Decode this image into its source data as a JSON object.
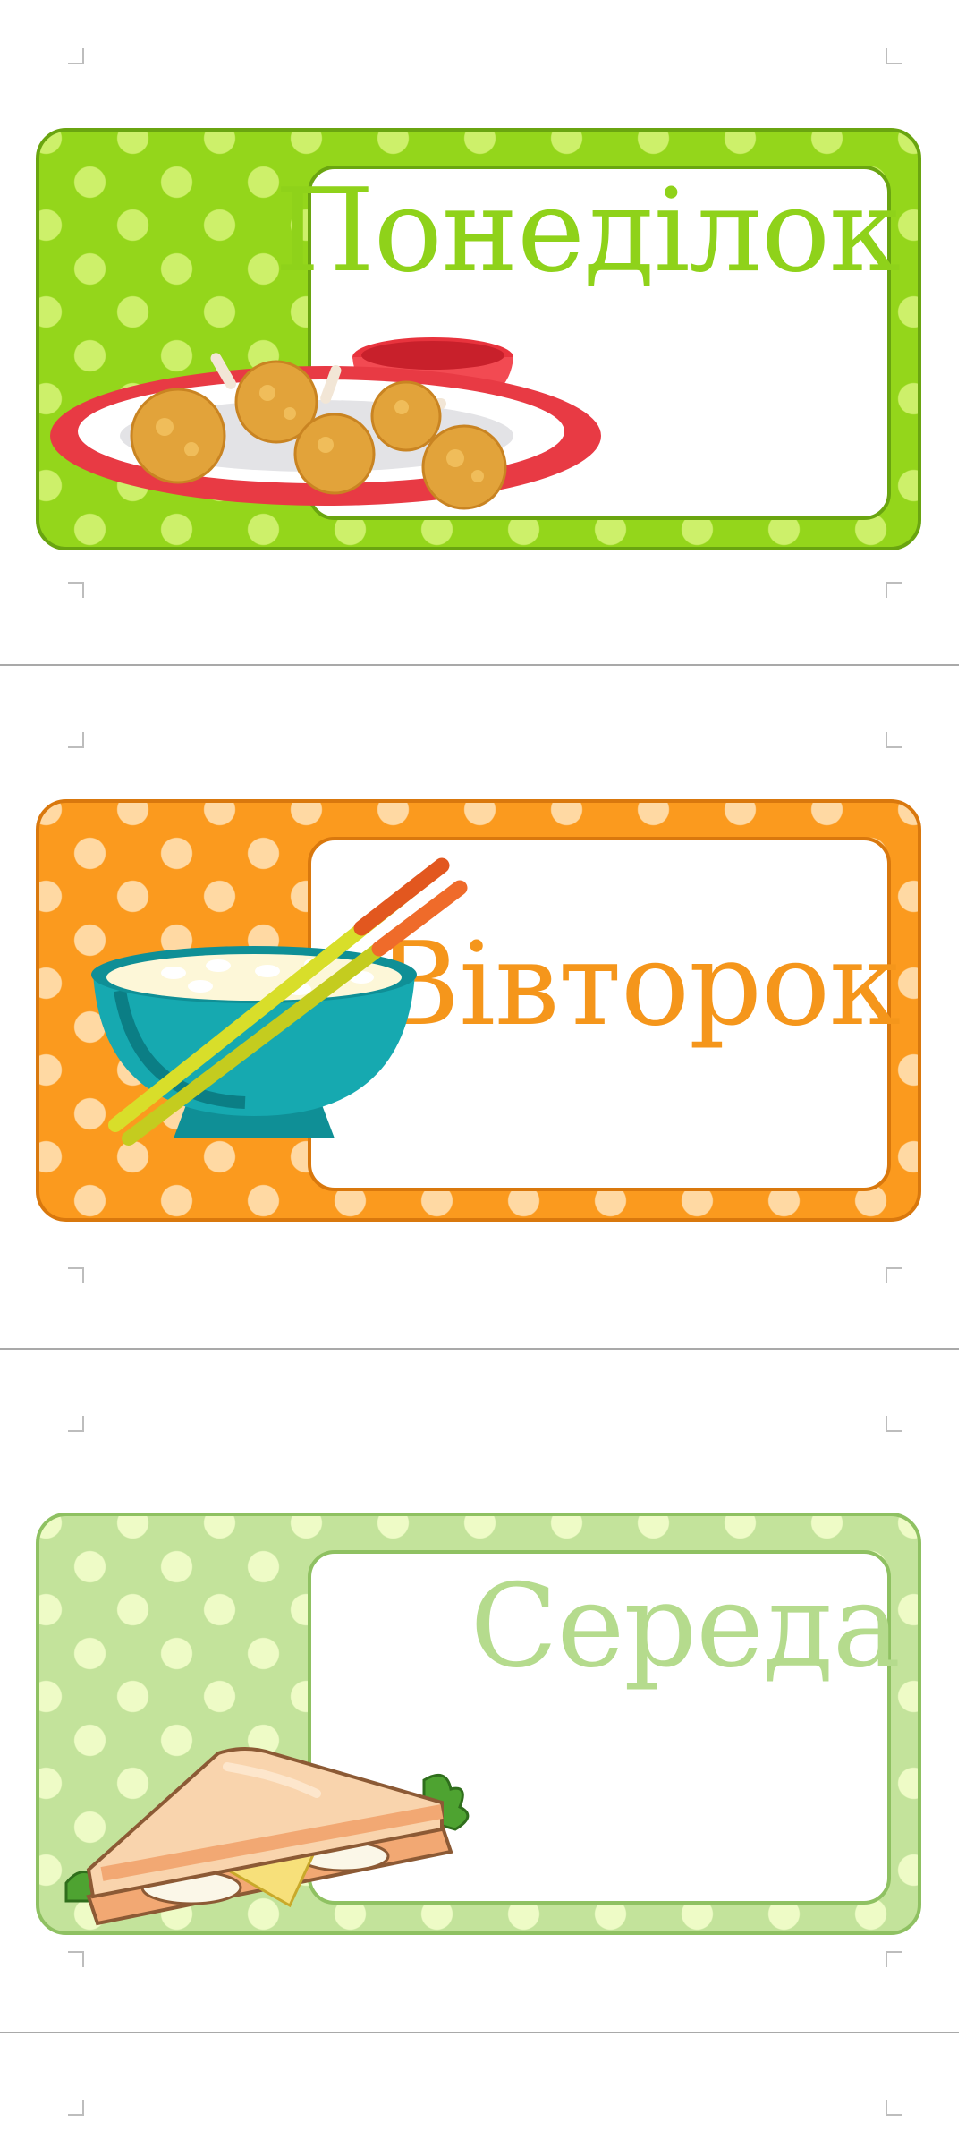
{
  "cards": [
    {
      "day": "Понеділок",
      "illustration": "fried-chicken-plate-icon"
    },
    {
      "day": "Вівторок",
      "illustration": "rice-bowl-chopsticks-icon"
    },
    {
      "day": "Середа",
      "illustration": "sandwich-icon"
    }
  ],
  "colors": {
    "monday_bg": "#94d61b",
    "monday_text": "#8fd21a",
    "tuesday_bg": "#fb9a1e",
    "tuesday_text": "#f5961b",
    "wednesday_bg": "#c3e39b",
    "wednesday_text": "#b5db8d"
  }
}
